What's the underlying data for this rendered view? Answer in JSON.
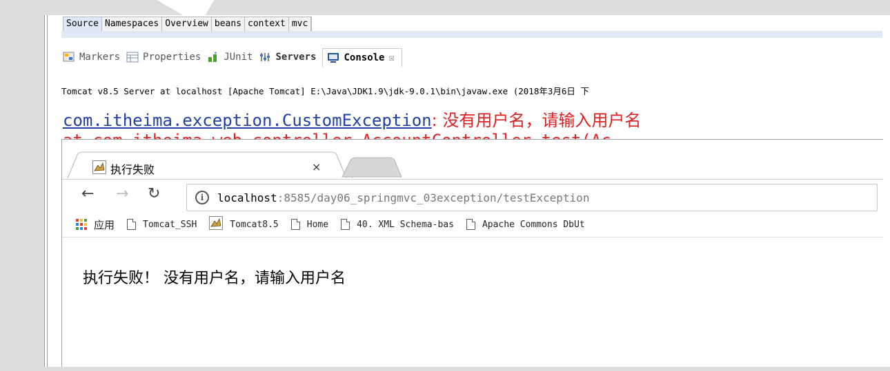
{
  "eclipse": {
    "editor_tabs": [
      "Source",
      "Namespaces",
      "Overview",
      "beans",
      "context",
      "mvc"
    ],
    "view_tabs": [
      {
        "label": "Markers",
        "icon": "markers-icon"
      },
      {
        "label": "Properties",
        "icon": "properties-icon"
      },
      {
        "label": "JUnit",
        "icon": "junit-icon"
      },
      {
        "label": "Servers",
        "icon": "servers-icon"
      },
      {
        "label": "Console",
        "icon": "console-icon",
        "close": "☒"
      }
    ],
    "console_header": "Tomcat v8.5 Server at localhost [Apache Tomcat] E:\\Java\\JDK1.9\\jdk-9.0.1\\bin\\javaw.exe (2018年3月6日 下",
    "exception_class": "com.itheima.exception.CustomException",
    "exception_message": ": 没有用户名，请输入用户名",
    "trace_line": "    at com.itheima.web.controller.AccountController.test(Ac"
  },
  "browser": {
    "tab_title": "执行失败",
    "tab_close": "×",
    "url_host": "localhost",
    "url_rest": ":8585/day06_springmvc_03exception/testException",
    "info_icon": "i",
    "bookmarks": [
      {
        "label": "应用",
        "icon": "apps-icon"
      },
      {
        "label": "Tomcat_SSH",
        "icon": "page-icon"
      },
      {
        "label": "Tomcat8.5",
        "icon": "tomcat-icon"
      },
      {
        "label": "Home",
        "icon": "page-icon"
      },
      {
        "label": "40.  XML Schema-bas",
        "icon": "page-icon"
      },
      {
        "label": "Apache Commons DbUt",
        "icon": "page-icon"
      }
    ],
    "page_text": "执行失败！ 没有用户名，请输入用户名"
  },
  "colors": {
    "link": "#1f3fa6",
    "error": "#e02020",
    "active_strip": "#dfe8f6"
  }
}
